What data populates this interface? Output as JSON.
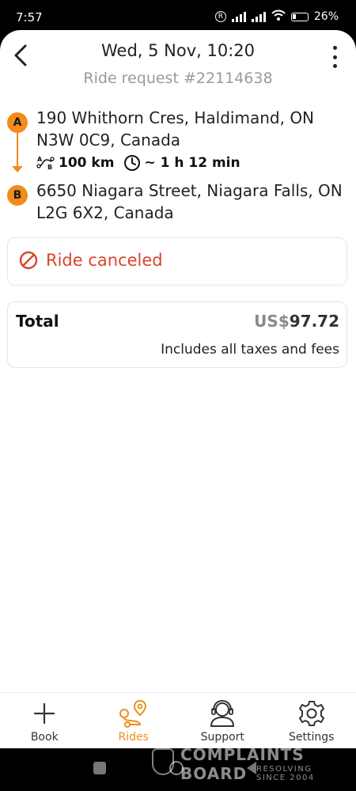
{
  "status_bar": {
    "time": "7:57",
    "battery": "26%"
  },
  "header": {
    "title": "Wed, 5 Nov, 10:20",
    "subtitle": "Ride request #22114638"
  },
  "route": {
    "pickup_marker": "A",
    "pickup_address": "190 Whithorn Cres, Haldimand, ON N3W 0C9, Canada",
    "distance": "100 km",
    "duration": "~ 1 h 12 min",
    "dropoff_marker": "B",
    "dropoff_address": "6650 Niagara Street, Niagara Falls, ON L2G 6X2, Canada",
    "accent_color": "#f08c1a"
  },
  "status": {
    "label": "Ride canceled",
    "color": "#d9452c",
    "icon": "prohibited-icon"
  },
  "total": {
    "label": "Total",
    "currency": "US$",
    "amount": "97.72",
    "note": "Includes all taxes and fees"
  },
  "tabs": [
    {
      "label": "Book",
      "icon": "plus-icon",
      "active": false
    },
    {
      "label": "Rides",
      "icon": "route-icon",
      "active": true
    },
    {
      "label": "Support",
      "icon": "headset-icon",
      "active": false
    },
    {
      "label": "Settings",
      "icon": "gear-icon",
      "active": false
    }
  ],
  "watermark": {
    "line1": "COMPLAINTS",
    "line2": "BOARD",
    "tagline": "RESOLVING SINCE 2004"
  }
}
